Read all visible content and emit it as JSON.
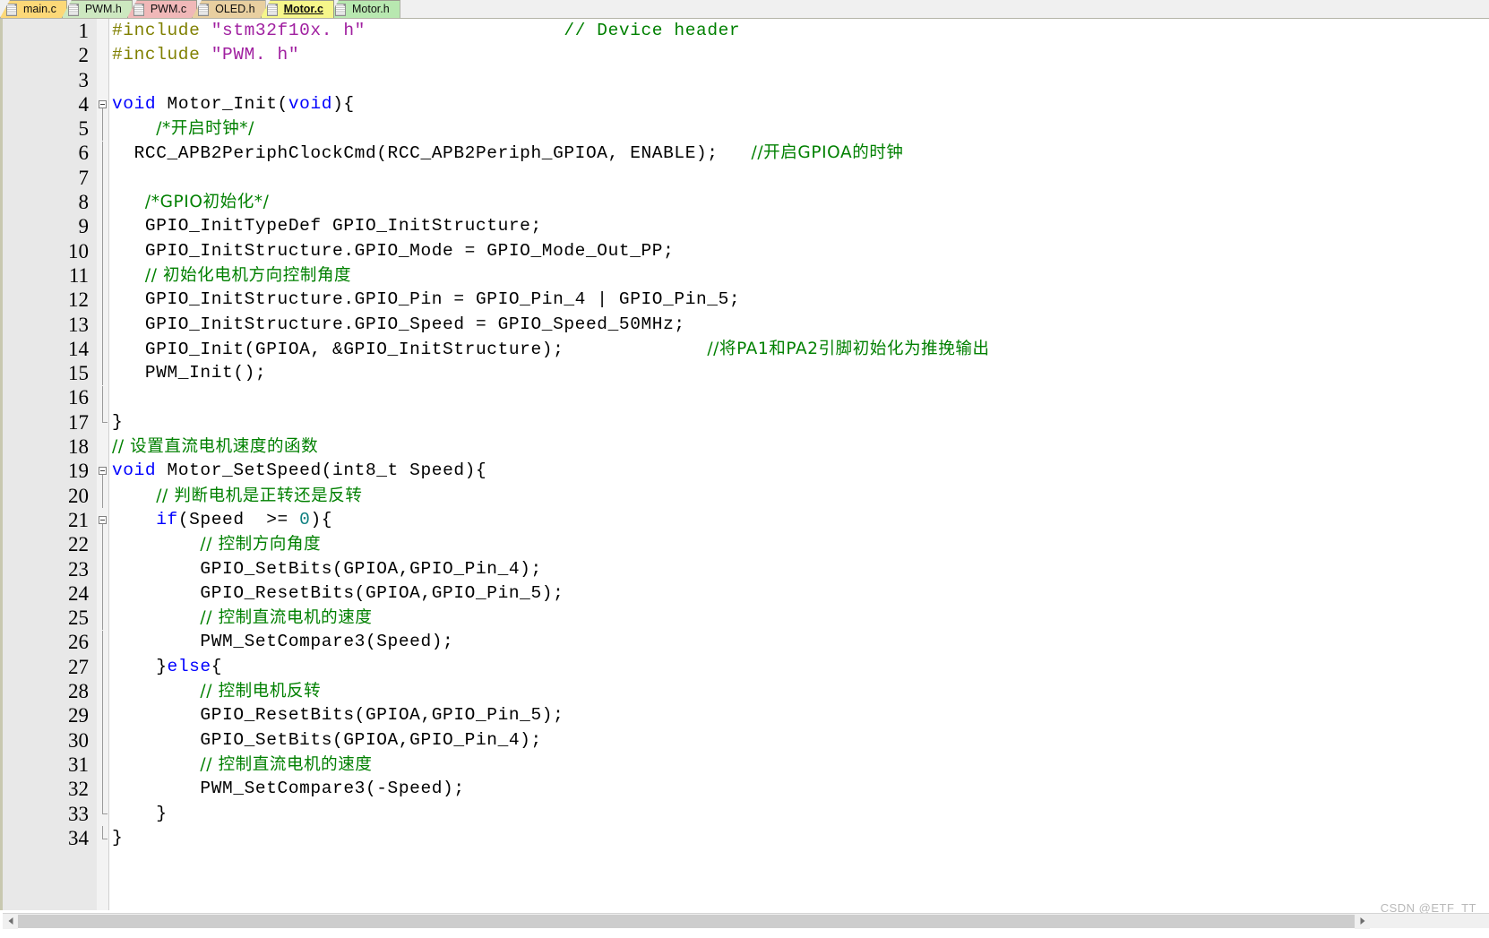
{
  "window": {
    "active_file": "Motor.c",
    "watermark": "CSDN @ETF_TT"
  },
  "tabs": [
    {
      "label": "main.c",
      "color": "#fcd878",
      "active": false,
      "icon": "document-icon"
    },
    {
      "label": "PWM.h",
      "color": "#cde8c0",
      "active": false,
      "icon": "document-icon"
    },
    {
      "label": "PWM.c",
      "color": "#f0b8b8",
      "active": false,
      "icon": "document-icon"
    },
    {
      "label": "OLED.h",
      "color": "#e8cfa0",
      "active": false,
      "icon": "document-icon"
    },
    {
      "label": "Motor.c",
      "color": "#f6f68a",
      "active": true,
      "icon": "document-icon"
    },
    {
      "label": "Motor.h",
      "color": "#b8e8b0",
      "active": false,
      "icon": "document-icon"
    }
  ],
  "colors": {
    "keyword": "#0000ff",
    "preprocessor": "#808000",
    "string": "#a020a0",
    "comment": "#008000",
    "number": "#0e8080",
    "plain": "#000000",
    "gutter_bg": "#e8e8e8",
    "editor_bg": "#ffffff",
    "tabbar_bg": "#f0f0f0"
  },
  "editor": {
    "first_line": 1,
    "last_line": 34,
    "total_lines": 34,
    "lines": [
      {
        "n": 1,
        "fold": "none",
        "tokens": [
          {
            "t": "#include ",
            "c": "pre"
          },
          {
            "t": "\"stm32f10x. h\"",
            "c": "str"
          },
          {
            "t": "                  ",
            "c": "plain"
          },
          {
            "t": "// Device header",
            "c": "cmt"
          }
        ]
      },
      {
        "n": 2,
        "fold": "none",
        "tokens": [
          {
            "t": "#include ",
            "c": "pre"
          },
          {
            "t": "\"PWM. h\"",
            "c": "str"
          }
        ]
      },
      {
        "n": 3,
        "fold": "none",
        "tokens": []
      },
      {
        "n": 4,
        "fold": "start",
        "tokens": [
          {
            "t": "void",
            "c": "kw"
          },
          {
            "t": " Motor_Init(",
            "c": "plain"
          },
          {
            "t": "void",
            "c": "kw"
          },
          {
            "t": "){",
            "c": "plain"
          }
        ]
      },
      {
        "n": 5,
        "fold": "bar",
        "tokens": [
          {
            "t": "    ",
            "c": "plain"
          },
          {
            "t": "/*开启时钟*/",
            "c": "cmt"
          }
        ]
      },
      {
        "n": 6,
        "fold": "bar",
        "tokens": [
          {
            "t": "  RCC_APB2PeriphClockCmd(RCC_APB2Periph_GPIOA, ENABLE);   ",
            "c": "plain"
          },
          {
            "t": "//开启GPIOA的时钟",
            "c": "cmt"
          }
        ]
      },
      {
        "n": 7,
        "fold": "bar",
        "tokens": []
      },
      {
        "n": 8,
        "fold": "bar",
        "tokens": [
          {
            "t": "   ",
            "c": "plain"
          },
          {
            "t": "/*GPIO初始化*/",
            "c": "cmt"
          }
        ]
      },
      {
        "n": 9,
        "fold": "bar",
        "tokens": [
          {
            "t": "   GPIO_InitTypeDef GPIO_InitStructure;",
            "c": "plain"
          }
        ]
      },
      {
        "n": 10,
        "fold": "bar",
        "tokens": [
          {
            "t": "   GPIO_InitStructure.GPIO_Mode = GPIO_Mode_Out_PP;",
            "c": "plain"
          }
        ]
      },
      {
        "n": 11,
        "fold": "bar",
        "tokens": [
          {
            "t": "   ",
            "c": "plain"
          },
          {
            "t": "// 初始化电机方向控制角度",
            "c": "cmt"
          }
        ]
      },
      {
        "n": 12,
        "fold": "bar",
        "tokens": [
          {
            "t": "   GPIO_InitStructure.GPIO_Pin = GPIO_Pin_4 | GPIO_Pin_5;",
            "c": "plain"
          }
        ]
      },
      {
        "n": 13,
        "fold": "bar",
        "tokens": [
          {
            "t": "   GPIO_InitStructure.GPIO_Speed = GPIO_Speed_50MHz;",
            "c": "plain"
          }
        ]
      },
      {
        "n": 14,
        "fold": "bar",
        "tokens": [
          {
            "t": "   GPIO_Init(GPIOA, &GPIO_InitStructure);             ",
            "c": "plain"
          },
          {
            "t": "//将PA1和PA2引脚初始化为推挽输出",
            "c": "cmt"
          }
        ]
      },
      {
        "n": 15,
        "fold": "bar",
        "tokens": [
          {
            "t": "   PWM_Init();",
            "c": "plain"
          }
        ]
      },
      {
        "n": 16,
        "fold": "bar",
        "tokens": []
      },
      {
        "n": 17,
        "fold": "end",
        "tokens": [
          {
            "t": "}",
            "c": "plain"
          }
        ]
      },
      {
        "n": 18,
        "fold": "none",
        "tokens": [
          {
            "t": "// 设置直流电机速度的函数",
            "c": "cmt"
          }
        ]
      },
      {
        "n": 19,
        "fold": "start",
        "tokens": [
          {
            "t": "void",
            "c": "kw"
          },
          {
            "t": " Motor_SetSpeed(int8_t Speed){",
            "c": "plain"
          }
        ]
      },
      {
        "n": 20,
        "fold": "bar",
        "tokens": [
          {
            "t": "    ",
            "c": "plain"
          },
          {
            "t": "// 判断电机是正转还是反转",
            "c": "cmt"
          }
        ]
      },
      {
        "n": 21,
        "fold": "start2",
        "tokens": [
          {
            "t": "    ",
            "c": "plain"
          },
          {
            "t": "if",
            "c": "kw"
          },
          {
            "t": "(Speed  >= ",
            "c": "plain"
          },
          {
            "t": "0",
            "c": "num"
          },
          {
            "t": "){",
            "c": "plain"
          }
        ]
      },
      {
        "n": 22,
        "fold": "bar2",
        "tokens": [
          {
            "t": "        ",
            "c": "plain"
          },
          {
            "t": "// 控制方向角度",
            "c": "cmt"
          }
        ]
      },
      {
        "n": 23,
        "fold": "bar2",
        "tokens": [
          {
            "t": "        GPIO_SetBits(GPIOA,GPIO_Pin_4);",
            "c": "plain"
          }
        ]
      },
      {
        "n": 24,
        "fold": "bar2",
        "tokens": [
          {
            "t": "        GPIO_ResetBits(GPIOA,GPIO_Pin_5);",
            "c": "plain"
          }
        ]
      },
      {
        "n": 25,
        "fold": "bar2",
        "tokens": [
          {
            "t": "        ",
            "c": "plain"
          },
          {
            "t": "// 控制直流电机的速度",
            "c": "cmt"
          }
        ]
      },
      {
        "n": 26,
        "fold": "bar2",
        "tokens": [
          {
            "t": "        PWM_SetCompare3(Speed);",
            "c": "plain"
          }
        ]
      },
      {
        "n": 27,
        "fold": "bar2",
        "tokens": [
          {
            "t": "    }",
            "c": "plain"
          },
          {
            "t": "else",
            "c": "kw"
          },
          {
            "t": "{",
            "c": "plain"
          }
        ]
      },
      {
        "n": 28,
        "fold": "bar2",
        "tokens": [
          {
            "t": "        ",
            "c": "plain"
          },
          {
            "t": "// 控制电机反转",
            "c": "cmt"
          }
        ]
      },
      {
        "n": 29,
        "fold": "bar2",
        "tokens": [
          {
            "t": "        GPIO_ResetBits(GPIOA,GPIO_Pin_5);",
            "c": "plain"
          }
        ]
      },
      {
        "n": 30,
        "fold": "bar2",
        "tokens": [
          {
            "t": "        GPIO_SetBits(GPIOA,GPIO_Pin_4);",
            "c": "plain"
          }
        ]
      },
      {
        "n": 31,
        "fold": "bar2",
        "tokens": [
          {
            "t": "        ",
            "c": "plain"
          },
          {
            "t": "// 控制直流电机的速度",
            "c": "cmt"
          }
        ]
      },
      {
        "n": 32,
        "fold": "bar2",
        "tokens": [
          {
            "t": "        PWM_SetCompare3(-Speed);",
            "c": "plain"
          }
        ]
      },
      {
        "n": 33,
        "fold": "end2",
        "tokens": [
          {
            "t": "    }",
            "c": "plain"
          }
        ]
      },
      {
        "n": 34,
        "fold": "end",
        "tokens": [
          {
            "t": "}",
            "c": "plain"
          }
        ]
      }
    ]
  },
  "scrollbar": {
    "left_arrow": "arrow-left-icon",
    "right_arrow": "arrow-right-icon",
    "thumb_percent": 92
  }
}
